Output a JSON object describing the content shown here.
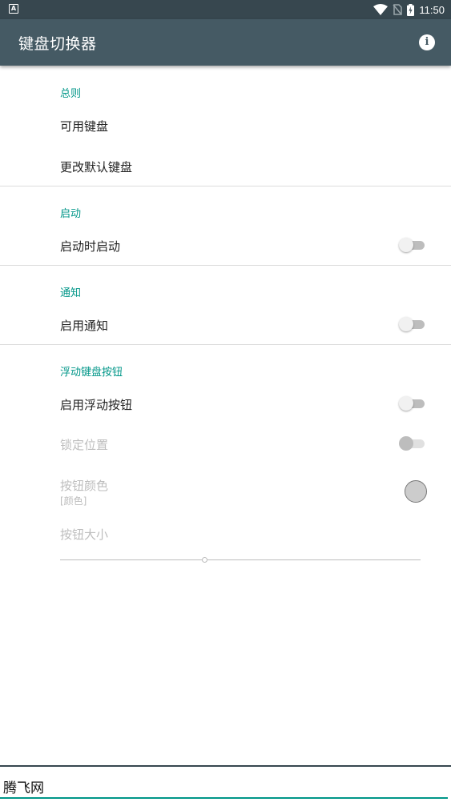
{
  "status_bar": {
    "time": "11:50",
    "left_icon": "android-notification-icon",
    "icons": [
      "wifi-icon",
      "no-sim-icon",
      "battery-charging-icon"
    ]
  },
  "toolbar": {
    "title": "键盘切换器",
    "info_icon": "info-icon"
  },
  "sections": {
    "general": {
      "header": "总则",
      "item1": "可用键盘",
      "item2": "更改默认键盘"
    },
    "startup": {
      "header": "启动",
      "item1": "启动时启动",
      "switch_on": false
    },
    "notification": {
      "header": "通知",
      "item1": "启用通知",
      "switch_on": false
    },
    "floating": {
      "header": "浮动键盘按钮",
      "enable": "启用浮动按钮",
      "lock": "锁定位置",
      "color_title": "按钮颜色",
      "color_summary": "[颜色]",
      "color_value": "#cccccc",
      "size_title": "按钮大小",
      "size_fraction": 0.4
    }
  },
  "bottom": {
    "text": "腾飞网"
  },
  "colors": {
    "accent": "#009688",
    "toolbar": "#455a64",
    "statusbar": "#37474f"
  }
}
